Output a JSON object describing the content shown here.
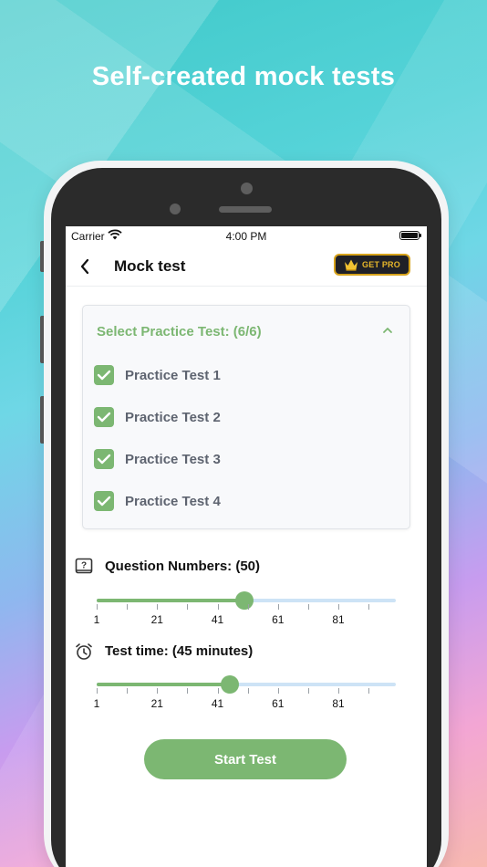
{
  "headline": "Self-created mock tests",
  "status_bar": {
    "carrier": "Carrier",
    "time": "4:00 PM"
  },
  "nav": {
    "title": "Mock test",
    "pro_label": "GET PRO"
  },
  "practice": {
    "header": "Select Practice Test: (6/6)",
    "items": [
      {
        "label": "Practice Test 1",
        "checked": true
      },
      {
        "label": "Practice Test 2",
        "checked": true
      },
      {
        "label": "Practice Test 3",
        "checked": true
      },
      {
        "label": "Practice Test 4",
        "checked": true
      }
    ]
  },
  "questions": {
    "label": "Question Numbers: (50)",
    "value": 50,
    "min": 1,
    "max": 100,
    "tick_labels": [
      "1",
      "21",
      "41",
      "61",
      "81"
    ]
  },
  "test_time": {
    "label": "Test time: (45 minutes)",
    "value": 45,
    "min": 1,
    "max": 100,
    "tick_labels": [
      "1",
      "21",
      "41",
      "61",
      "81"
    ]
  },
  "start_button": "Start Test",
  "colors": {
    "accent_green": "#7cb772",
    "track_blue": "#cde3f6",
    "pro_gold": "#e6b62a"
  }
}
